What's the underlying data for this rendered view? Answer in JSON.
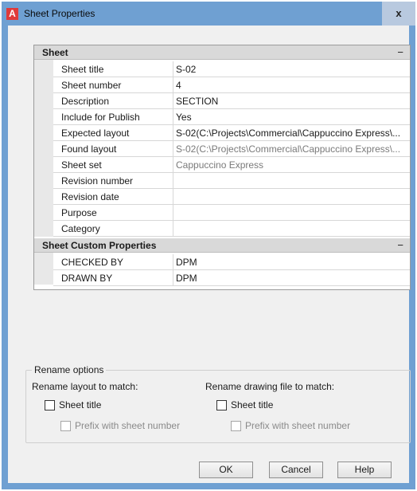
{
  "window": {
    "title": "Sheet Properties",
    "app_icon_letter": "A",
    "close_glyph": "x"
  },
  "sections": {
    "sheet": {
      "title": "Sheet",
      "collapse_glyph": "−",
      "rows": [
        {
          "label": "Sheet title",
          "value": "S-02"
        },
        {
          "label": "Sheet number",
          "value": "4"
        },
        {
          "label": "Description",
          "value": "SECTION"
        },
        {
          "label": "Include for Publish",
          "value": "Yes"
        },
        {
          "label": "Expected layout",
          "value": "S-02(C:\\Projects\\Commercial\\Cappuccino Express\\..."
        },
        {
          "label": "Found layout",
          "value": "S-02(C:\\Projects\\Commercial\\Cappuccino Express\\..."
        },
        {
          "label": "Sheet set",
          "value": "Cappuccino Express"
        },
        {
          "label": "Revision number",
          "value": ""
        },
        {
          "label": "Revision date",
          "value": ""
        },
        {
          "label": "Purpose",
          "value": ""
        },
        {
          "label": "Category",
          "value": ""
        }
      ]
    },
    "custom": {
      "title": "Sheet Custom Properties",
      "collapse_glyph": "−",
      "rows": [
        {
          "label": "CHECKED BY",
          "value": "DPM"
        },
        {
          "label": "DRAWN BY",
          "value": "DPM"
        }
      ]
    }
  },
  "rename_options": {
    "legend": "Rename options",
    "layout": {
      "heading": "Rename layout to match:",
      "sheet_title": "Sheet title",
      "prefix": "Prefix with sheet number"
    },
    "drawing": {
      "heading": "Rename drawing file to match:",
      "sheet_title": "Sheet title",
      "prefix": "Prefix with sheet number"
    }
  },
  "buttons": {
    "ok": "OK",
    "cancel": "Cancel",
    "help": "Help"
  }
}
